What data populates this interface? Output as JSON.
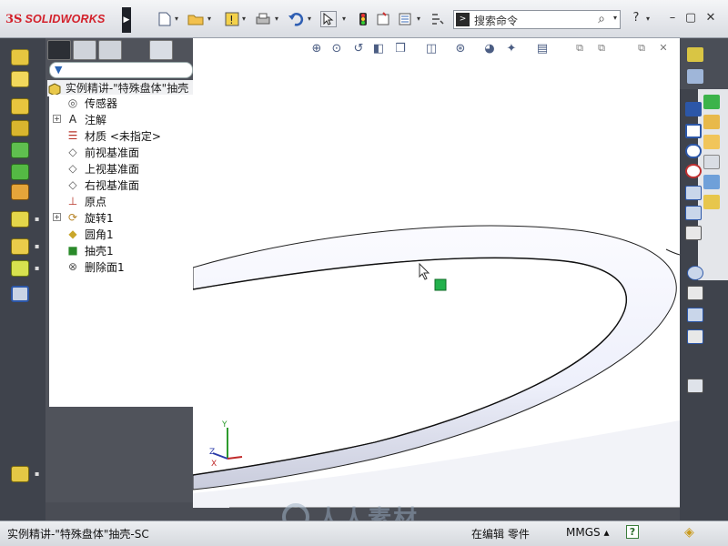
{
  "app": {
    "logo_prefix": "3S",
    "logo_name": "SOLIDWORKS"
  },
  "toolbar": {
    "menu_arrow": "▶",
    "icons": [
      "new-document-icon",
      "open-folder-icon",
      "rebuild-icon",
      "print-icon",
      "undo-icon",
      "select-pointer-icon",
      "traffic-light-icon",
      "options-icon",
      "file-properties-icon",
      "customize-icon"
    ],
    "search_placeholder": "搜索命令",
    "help_label": "?",
    "window_controls": [
      "–",
      "▢",
      "✕"
    ]
  },
  "heads_up": {
    "icons": [
      "zoom-to-fit-icon",
      "zoom-area-icon",
      "previous-view-icon",
      "section-view-icon",
      "view-orientation-icon",
      "display-style-icon",
      "hide-show-icon",
      "edit-appearance-icon",
      "apply-scene-icon",
      "view-settings-icon"
    ],
    "window_controls": [
      "⧉",
      "⧉",
      "⧉",
      "✕"
    ]
  },
  "feature_manager": {
    "filter_icon": "▼",
    "root_label": "实例精讲-\"特殊盘体\"抽壳",
    "items": [
      {
        "label": "传感器",
        "icon": "sensor-icon",
        "expandable": false
      },
      {
        "label": "注解",
        "icon": "annotation-icon",
        "expandable": true
      },
      {
        "label": "材质 <未指定>",
        "icon": "material-icon",
        "expandable": false
      },
      {
        "label": "前视基准面",
        "icon": "plane-icon",
        "expandable": false
      },
      {
        "label": "上视基准面",
        "icon": "plane-icon",
        "expandable": false
      },
      {
        "label": "右视基准面",
        "icon": "plane-icon",
        "expandable": false
      },
      {
        "label": "原点",
        "icon": "origin-icon",
        "expandable": false
      },
      {
        "label": "旋转1",
        "icon": "revolve-icon",
        "expandable": true
      },
      {
        "label": "圆角1",
        "icon": "fillet-icon",
        "expandable": false
      },
      {
        "label": "抽壳1",
        "icon": "shell-icon",
        "expandable": false
      },
      {
        "label": "删除面1",
        "icon": "delete-face-icon",
        "expandable": false
      }
    ]
  },
  "triad": {
    "y": "Y",
    "z": "Z",
    "x": "X"
  },
  "statusbar": {
    "document": "实例精讲-\"特殊盘体\"抽壳-SC",
    "mode": "在编辑 零件",
    "units": "MMGS ▴",
    "help": "?"
  },
  "watermark": "人人素材",
  "colors": {
    "accent": "#d3202a",
    "panel_bg": "#3f434c",
    "selected_handle": "#22b14c"
  }
}
